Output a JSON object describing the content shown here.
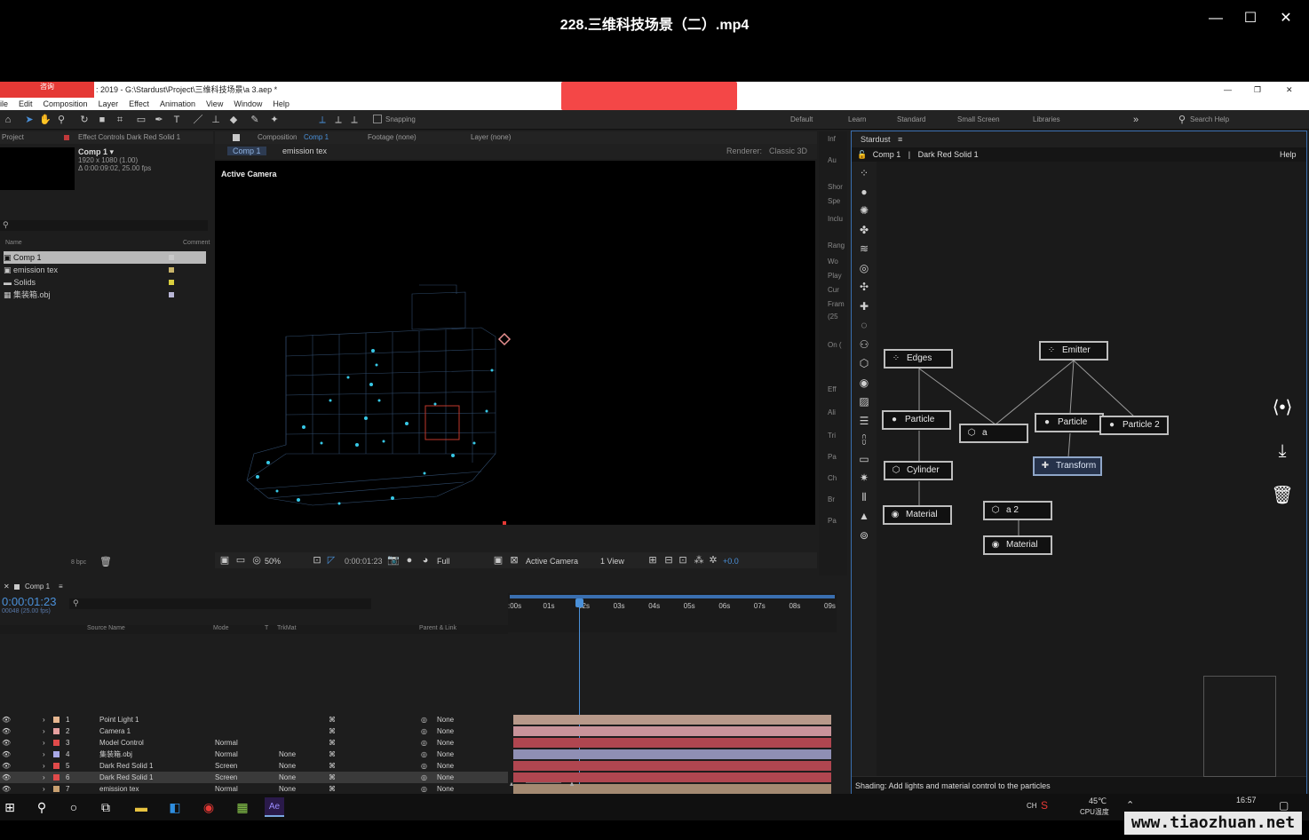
{
  "player": {
    "title": "228.三维科技场景（二）.mp4",
    "minimize": "—",
    "maximize": "☐",
    "close": "✕"
  },
  "ae": {
    "title_text": ": 2019 - G:\\Stardust\\Project\\三维科技场景\\a 3.aep *",
    "red_tab_label": "咨询",
    "menu": [
      "ile",
      "Edit",
      "Composition",
      "Layer",
      "Effect",
      "Animation",
      "View",
      "Window",
      "Help"
    ],
    "toolbar": {
      "snapping_label": "Snapping",
      "workspaces": [
        "Default",
        "Learn",
        "Standard",
        "Small Screen",
        "Libraries"
      ],
      "search_help": "Search Help"
    },
    "project": {
      "tab_label": "Project",
      "effect_controls": "Effect Controls Dark Red Solid 1",
      "comp_name": "Comp 1 ▾",
      "comp_res": "1920 x 1080 (1.00)",
      "comp_dur": "Δ 0:00:09:02, 25.00 fps",
      "col_name": "Name",
      "col_comment": "Comment",
      "items": [
        {
          "name": "Comp 1",
          "color": "#c9c9c9"
        },
        {
          "name": "emission tex",
          "color": "#c8b46a"
        },
        {
          "name": "Solids",
          "color": "#d9cf3e"
        },
        {
          "name": "集装箱.obj",
          "color": "#b8b6d6"
        }
      ],
      "bpc": "8 bpc"
    },
    "composition": {
      "tab_label": "Composition",
      "tab_comp": "Comp 1",
      "footage": "Footage (none)",
      "layer": "Layer (none)",
      "subtab_comp": "Comp 1",
      "subtab_emission": "emission tex",
      "renderer_label": "Renderer:",
      "renderer_value": "Classic 3D",
      "active_camera_label": "Active Camera",
      "zoom": "50%",
      "timecode": "0:00:01:23",
      "resolution": "Full",
      "view_camera": "Active Camera",
      "view_count": "1 View",
      "exposure": "+0.0"
    },
    "info_strip": [
      "Inf",
      "Au",
      "Shor",
      "Spe",
      "Inclu",
      "Rang",
      "Wo",
      "Play",
      "Cur",
      "Fram",
      "(25",
      "On (",
      "Eff",
      "Ali",
      "Tri",
      "Pa",
      "Ch",
      "Br",
      "Pa"
    ],
    "stardust": {
      "panel_title": "Stardust",
      "breadcrumb_comp": "Comp 1",
      "breadcrumb_layer": "Dark Red Solid 1",
      "help": "Help",
      "nodes": {
        "edges": "Edges",
        "emitter": "Emitter",
        "particle1": "Particle",
        "a": "a",
        "particle2": "Particle",
        "particle3": "Particle 2",
        "cylinder": "Cylinder",
        "transform": "Transform",
        "material1": "Material",
        "a2": "a 2",
        "material2": "Material"
      },
      "status": "Shading: Add lights and material control to the particles"
    },
    "timeline": {
      "tab_label": "Comp 1",
      "timecode": "0:00:01:23",
      "frame_info": "00048 (25.00 fps)",
      "col_source": "Source Name",
      "col_mode": "Mode",
      "col_t": "T",
      "col_trkmat": "TrkMat",
      "col_parent": "Parent & Link",
      "ticks": [
        ":00s",
        "01s",
        "02s",
        "03s",
        "04s",
        "05s",
        "06s",
        "07s",
        "08s",
        "09s"
      ],
      "layers": [
        {
          "num": "1",
          "name": "Point Light 1",
          "label": "#e6b690",
          "mode": "",
          "trkmat": "",
          "parent": "None",
          "bar": "#b8998a"
        },
        {
          "num": "2",
          "name": "Camera 1",
          "label": "#e6a0a0",
          "mode": "",
          "trkmat": "",
          "parent": "None",
          "bar": "#c8939a"
        },
        {
          "num": "3",
          "name": "Model Control",
          "label": "#e04a4a",
          "mode": "Normal",
          "trkmat": "",
          "parent": "None",
          "bar": "#b04650"
        },
        {
          "num": "4",
          "name": "集装箱.obj",
          "label": "#a8a8e6",
          "mode": "Normal",
          "trkmat": "None",
          "parent": "None",
          "bar": "#8f8fb4"
        },
        {
          "num": "5",
          "name": "Dark Red Solid 1",
          "label": "#e04a4a",
          "mode": "Screen",
          "trkmat": "None",
          "parent": "None",
          "bar": "#b04650"
        },
        {
          "num": "6",
          "name": "Dark Red Solid 1",
          "label": "#e04a4a",
          "mode": "Screen",
          "trkmat": "None",
          "parent": "None",
          "bar": "#b04650"
        },
        {
          "num": "7",
          "name": "emission tex",
          "label": "#c8a070",
          "mode": "Normal",
          "trkmat": "None",
          "parent": "None",
          "bar": "#a48a72"
        }
      ]
    }
  },
  "taskbar": {
    "temp": "45℃",
    "temp_label": "CPU温度",
    "lang": "CH",
    "time": "16:57"
  },
  "watermark": "www.tiaozhuan.net",
  "colors": {
    "accent_blue": "#3a6fb0",
    "playhead": "#4a90d9",
    "red": "#f44747"
  }
}
